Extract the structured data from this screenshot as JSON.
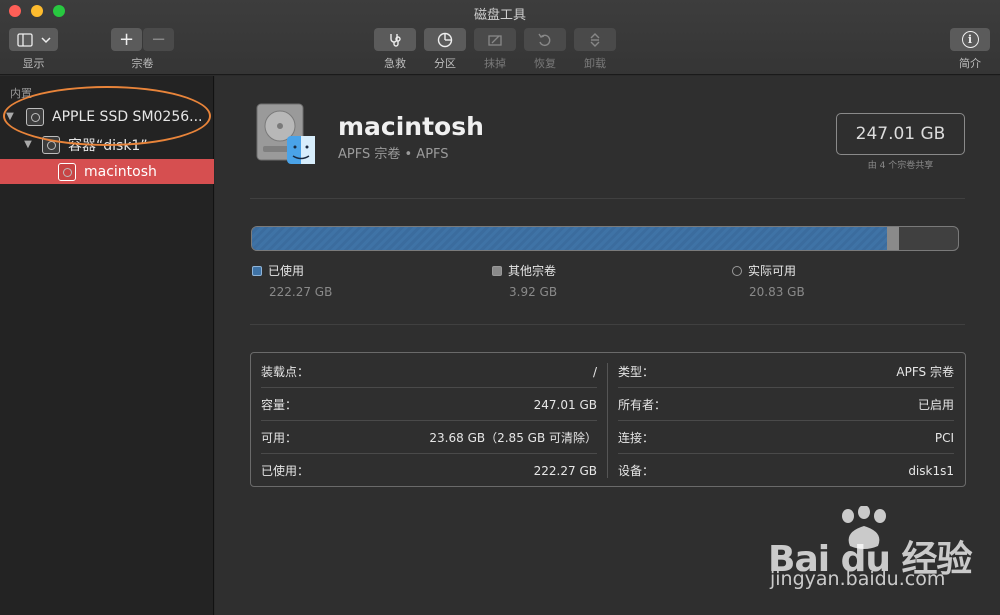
{
  "window": {
    "title": "磁盘工具"
  },
  "toolbar": {
    "view_label": "显示",
    "volume_label": "宗卷",
    "firstaid_label": "急救",
    "partition_label": "分区",
    "erase_label": "抹掉",
    "restore_label": "恢复",
    "unmount_label": "卸载",
    "info_label": "简介",
    "plus_glyph": "+",
    "minus_glyph": "−",
    "info_glyph": "i"
  },
  "sidebar": {
    "section": "内置",
    "items": [
      {
        "label": "APPLE SSD SM0256...",
        "icon": "internal-disk-icon",
        "level": 0
      },
      {
        "label": "容器“disk1”",
        "icon": "container-icon",
        "level": 1
      },
      {
        "label": "macintosh",
        "icon": "volume-icon",
        "level": 2,
        "selected": true
      }
    ],
    "selected_color": "#d64f50"
  },
  "volume": {
    "name": "macintosh",
    "subtitle": "APFS 宗卷 • APFS",
    "capacity": "247.01 GB",
    "shared_note": "由 4 个宗卷共享"
  },
  "usage": {
    "used_fraction": 0.9,
    "other_fraction": 0.016,
    "used_color": "#3f73a6",
    "other_color": "#8a8a8a",
    "legend": [
      {
        "label": "已使用",
        "value": "222.27 GB"
      },
      {
        "label": "其他宗卷",
        "value": "3.92 GB"
      },
      {
        "label": "实际可用",
        "value": "20.83 GB"
      }
    ]
  },
  "info": {
    "left": [
      {
        "key": "装载点：",
        "value": "/"
      },
      {
        "key": "容量：",
        "value": "247.01 GB"
      },
      {
        "key": "可用：",
        "value": "23.68 GB（2.85 GB 可清除）"
      },
      {
        "key": "已使用：",
        "value": "222.27 GB"
      }
    ],
    "right": [
      {
        "key": "类型：",
        "value": "APFS 宗卷"
      },
      {
        "key": "所有者：",
        "value": "已启用"
      },
      {
        "key": "连接：",
        "value": "PCI"
      },
      {
        "key": "设备：",
        "value": "disk1s1"
      }
    ]
  },
  "watermark": {
    "brand": "Bai du 经验",
    "url": "jingyan.baidu.com"
  }
}
